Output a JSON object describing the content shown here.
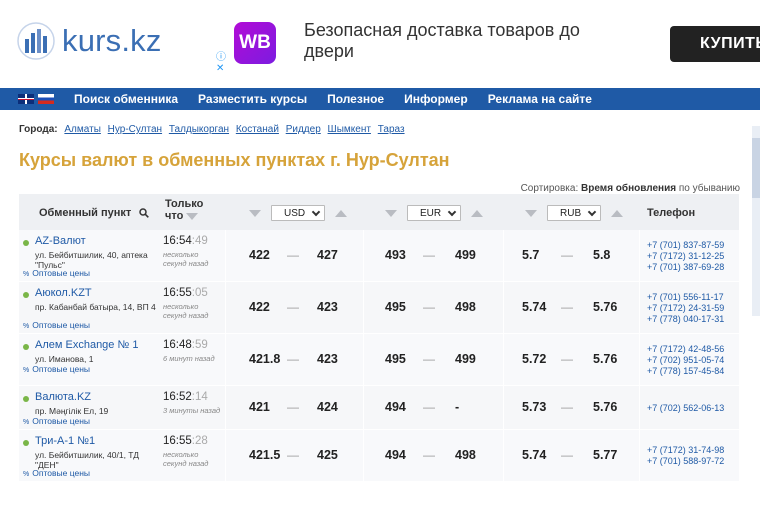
{
  "header": {
    "logo_text": "kurs.kz",
    "ad": {
      "brand": "WB",
      "text": "Безопасная доставка товаров до двери",
      "button": "КУПИТЬ",
      "info_icon": "ⓘ",
      "close_icon": "✕"
    }
  },
  "nav": {
    "items": [
      "Поиск обменника",
      "Разместить курсы",
      "Полезное",
      "Информер",
      "Реклама на сайте"
    ]
  },
  "cities": {
    "label": "Города:",
    "items": [
      "Алматы",
      "Нур-Султан",
      "Талдыкорган",
      "Костанай",
      "Риддер",
      "Шымкент",
      "Тараз"
    ]
  },
  "page_title": "Курсы валют в обменных пунктах г. Нур-Султан",
  "sort": {
    "label": "Сортировка:",
    "value": "Время обновления",
    "suffix": "по убыванию"
  },
  "table": {
    "headers": {
      "name": "Обменный пункт",
      "time_line1": "Только",
      "time_line2": "что",
      "usd": "USD",
      "eur": "EUR",
      "rub": "RUB",
      "phone": "Телефон"
    },
    "opt_label": "Оптовые цены",
    "rows": [
      {
        "name": "AZ-Валют",
        "addr": "ул. Бейбитшилик, 40, аптека \"Пульс\"",
        "time": "16:54",
        "sec": ":49",
        "ago": "несколько секунд назад",
        "usd_buy": "422",
        "usd_sell": "427",
        "eur_buy": "493",
        "eur_sell": "499",
        "rub_buy": "5.7",
        "rub_sell": "5.8",
        "phones": [
          "+7 (701) 837-87-59",
          "+7 (7172) 31-12-25",
          "+7 (701) 387-69-28"
        ]
      },
      {
        "name": "Аюкол.KZT",
        "addr": "пр. Кабанбай батыра, 14, ВП 4",
        "time": "16:55",
        "sec": ":05",
        "ago": "несколько секунд назад",
        "usd_buy": "422",
        "usd_sell": "423",
        "eur_buy": "495",
        "eur_sell": "498",
        "rub_buy": "5.74",
        "rub_sell": "5.76",
        "phones": [
          "+7 (701) 556-11-17",
          "+7 (7172) 24-31-59",
          "+7 (778) 040-17-31"
        ]
      },
      {
        "name": "Алем Exchange № 1",
        "addr": "ул. Иманова, 1",
        "time": "16:48",
        "sec": ":59",
        "ago": "6 минут назад",
        "usd_buy": "421.8",
        "usd_sell": "423",
        "eur_buy": "495",
        "eur_sell": "499",
        "rub_buy": "5.72",
        "rub_sell": "5.76",
        "phones": [
          "+7 (7172) 42-48-56",
          "+7 (702) 951-05-74",
          "+7 (778) 157-45-84"
        ]
      },
      {
        "name": "Валюта.KZ",
        "addr": "пр. Мәңгілік Ел, 19",
        "time": "16:52",
        "sec": ":14",
        "ago": "3 минуты назад",
        "usd_buy": "421",
        "usd_sell": "424",
        "eur_buy": "494",
        "eur_sell": "-",
        "rub_buy": "5.73",
        "rub_sell": "5.76",
        "phones": [
          "+7 (702) 562-06-13"
        ]
      },
      {
        "name": "Три-А-1 №1",
        "addr": "ул. Бейбитшилик, 40/1, ТД \"ДЕН\"",
        "time": "16:55",
        "sec": ":28",
        "ago": "несколько секунд назад",
        "usd_buy": "421.5",
        "usd_sell": "425",
        "eur_buy": "494",
        "eur_sell": "498",
        "rub_buy": "5.74",
        "rub_sell": "5.77",
        "phones": [
          "+7 (7172) 31-74-98",
          "+7 (701) 588-97-72"
        ]
      }
    ]
  },
  "colors": {
    "nav_bg": "#1f5aa6",
    "title": "#d6a33a",
    "link": "#1f5aa6",
    "dot": "#7ab648"
  }
}
